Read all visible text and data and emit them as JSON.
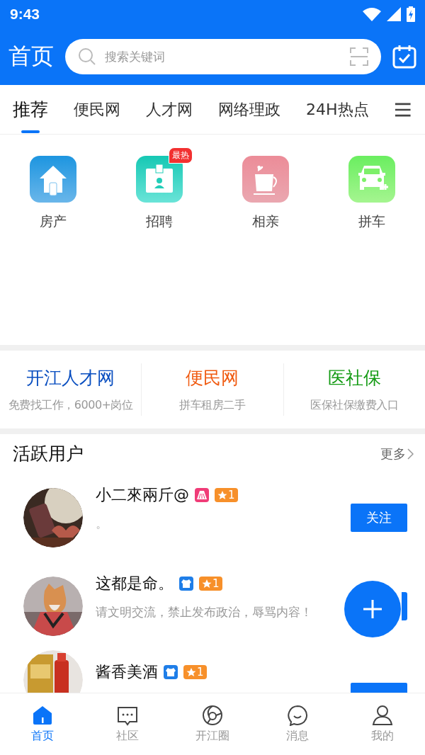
{
  "status_bar": {
    "time": "9:43"
  },
  "header": {
    "title": "首页",
    "search": {
      "placeholder": "搜索关键词"
    }
  },
  "tabs": [
    {
      "label": "推荐",
      "selected": true
    },
    {
      "label": "便民网",
      "selected": false
    },
    {
      "label": "人才网",
      "selected": false
    },
    {
      "label": "网络理政",
      "selected": false
    },
    {
      "label": "24H热点",
      "selected": false
    }
  ],
  "services": [
    {
      "label": "房产",
      "kind": "house"
    },
    {
      "label": "招聘",
      "kind": "badge-card",
      "badge": "最热"
    },
    {
      "label": "相亲",
      "kind": "cup"
    },
    {
      "label": "拼车",
      "kind": "car"
    }
  ],
  "quick_links": [
    {
      "title": "开江人才网",
      "subtitle": "免费找工作，6000+岗位",
      "color": "#0a4fc0"
    },
    {
      "title": "便民网",
      "subtitle": "拼车租房二手",
      "color": "#f05a10"
    },
    {
      "title": "医社保",
      "subtitle": "医保社保缴费入口",
      "color": "#129a12"
    }
  ],
  "active_users": {
    "title": "活跃用户",
    "more": "更多",
    "users": [
      {
        "name": "小二來兩斤@",
        "kind": "skirt",
        "level": "1",
        "bio": "。",
        "follow": "关注"
      },
      {
        "name": "这都是命。",
        "kind": "shirt",
        "level": "1",
        "bio": "请文明交流，禁止发布政治，辱骂内容！"
      },
      {
        "name": "酱香美酒",
        "kind": "shirt",
        "level": "1"
      }
    ]
  },
  "bottom_nav": [
    {
      "label": "首页",
      "kind": "home",
      "selected": true
    },
    {
      "label": "社区",
      "kind": "chat",
      "selected": false
    },
    {
      "label": "开江圈",
      "kind": "circle",
      "selected": false
    },
    {
      "label": "消息",
      "kind": "smile",
      "selected": false
    },
    {
      "label": "我的",
      "kind": "person",
      "selected": false
    }
  ]
}
